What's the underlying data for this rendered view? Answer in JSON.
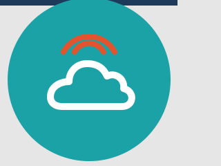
{
  "app_icon": {
    "name": "cloud-connectivity-app",
    "circle_color": "#1aa2a7",
    "cloud_color": "#ffffff",
    "signal_color": "#e1542d",
    "frame_background": "#e6e6e6",
    "top_bar_color": "#1e3a5b",
    "icons": [
      "cloud-icon",
      "wifi-signal-icon"
    ]
  }
}
